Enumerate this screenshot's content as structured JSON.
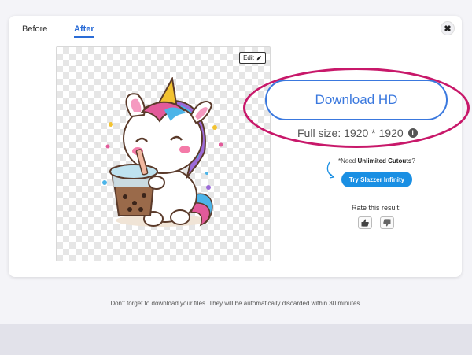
{
  "tabs": [
    {
      "label": "Before",
      "active": false
    },
    {
      "label": "After",
      "active": true
    }
  ],
  "close_label": "✖",
  "preview": {
    "edit_label": "Edit",
    "edit_icon": "pencil-icon"
  },
  "download": {
    "button_label": "Download HD",
    "full_size_label": "Full size: 1920 * 1920",
    "info_icon": "i"
  },
  "promo": {
    "need_prefix": "*Need ",
    "need_bold": "Unlimited Cutouts",
    "need_suffix": "?",
    "try_button_label": "Try Slazzer Infinity"
  },
  "rating": {
    "label": "Rate this result:",
    "up_icon": "thumbs-up-icon",
    "down_icon": "thumbs-down-icon"
  },
  "notice": "Don't forget to download your files. They will be automatically discarded within 30 minutes.",
  "colors": {
    "accent": "#3a78de",
    "highlight": "#c8186a",
    "try_button": "#1a8fe3"
  }
}
